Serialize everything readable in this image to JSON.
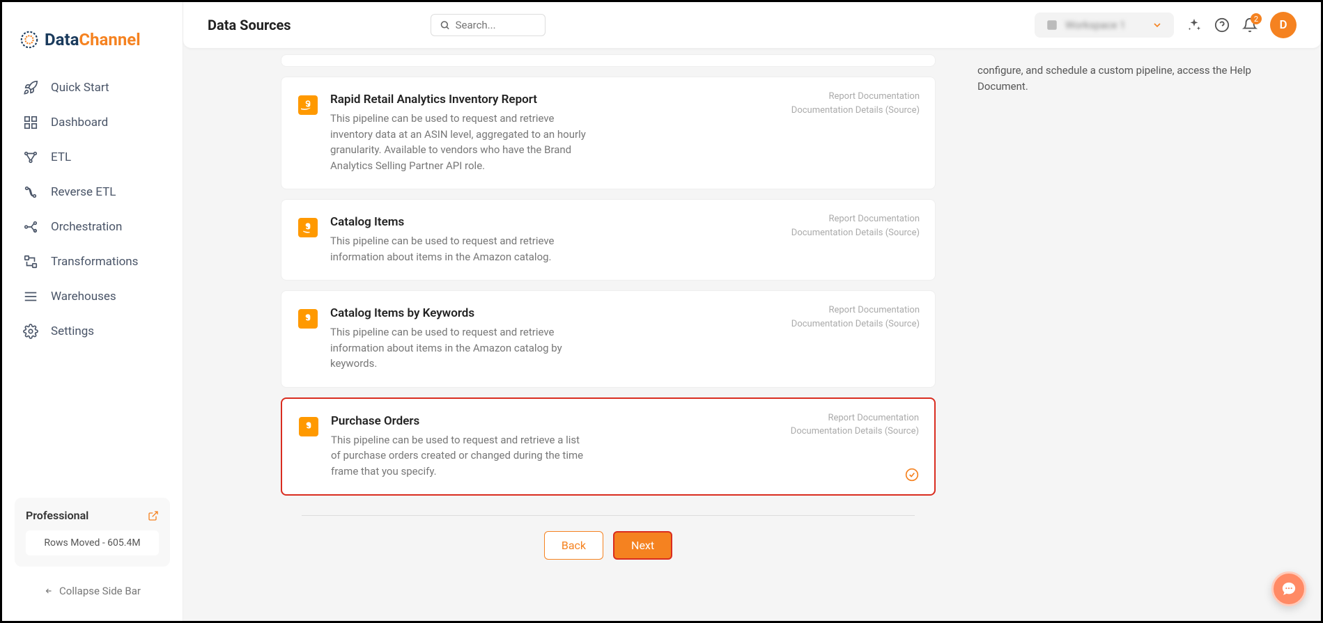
{
  "logo": {
    "part1": "Data",
    "part2": "Channel"
  },
  "sidebar": {
    "items": [
      {
        "label": "Quick Start"
      },
      {
        "label": "Dashboard"
      },
      {
        "label": "ETL"
      },
      {
        "label": "Reverse ETL"
      },
      {
        "label": "Orchestration"
      },
      {
        "label": "Transformations"
      },
      {
        "label": "Warehouses"
      },
      {
        "label": "Settings"
      }
    ],
    "plan": {
      "name": "Professional",
      "rows": "Rows Moved - 605.4M"
    },
    "collapse": "Collapse Side Bar"
  },
  "header": {
    "title": "Data Sources",
    "search_placeholder": "Search...",
    "workspace": "Workspace 1",
    "notif_count": "2",
    "avatar_letter": "D"
  },
  "right_panel": {
    "text": "configure, and schedule a custom pipeline, access the Help Document."
  },
  "pipelines": [
    {
      "title": "Rapid Retail Analytics Inventory Report",
      "desc": "This pipeline can be used to request and retrieve inventory data at an ASIN level, aggregated to an hourly granularity. Available to vendors who have the Brand Analytics Selling Partner API role.",
      "link1": "Report Documentation",
      "link2": "Documentation Details (Source)"
    },
    {
      "title": "Catalog Items",
      "desc": "This pipeline can be used to request and retrieve information about items in the Amazon catalog.",
      "link1": "Report Documentation",
      "link2": "Documentation Details (Source)"
    },
    {
      "title": "Catalog Items by Keywords",
      "desc": "This pipeline can be used to request and retrieve information about items in the Amazon catalog by keywords.",
      "link1": "Report Documentation",
      "link2": "Documentation Details (Source)"
    },
    {
      "title": "Purchase Orders",
      "desc": "This pipeline can be used to request and retrieve a list of purchase orders created or changed during the time frame that you specify.",
      "link1": "Report Documentation",
      "link2": "Documentation Details (Source)"
    }
  ],
  "buttons": {
    "back": "Back",
    "next": "Next"
  }
}
